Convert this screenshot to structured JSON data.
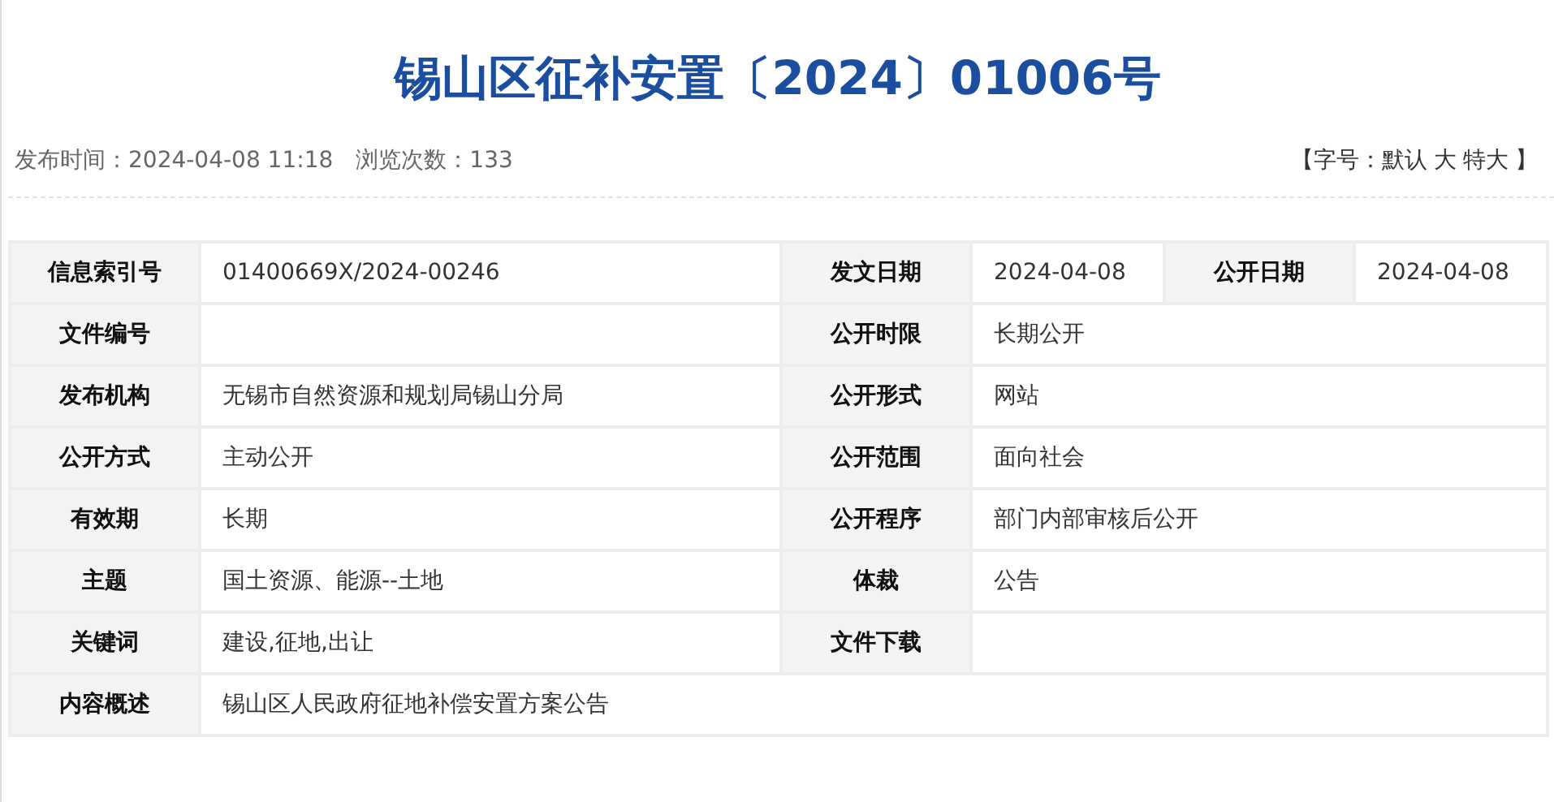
{
  "title": "锡山区征补安置〔2024〕01006号",
  "meta": {
    "published": "发布时间：2024-04-08 11:18",
    "views": "浏览次数：133"
  },
  "font_size": {
    "open": "【字号：",
    "options": [
      "默认",
      "大",
      "特大"
    ],
    "close": "】"
  },
  "table": {
    "rows": [
      {
        "cells": [
          {
            "label": "信息索引号",
            "value": "01400669X/2024-00246"
          },
          {
            "label": "发文日期",
            "value": "2024-04-08"
          },
          {
            "label": "公开日期",
            "value": "2024-04-08"
          }
        ]
      },
      {
        "cells": [
          {
            "label": "文件编号"
          },
          {
            "label": "公开时限",
            "value": "长期公开"
          }
        ]
      },
      {
        "cells": [
          {
            "label": "发布机构",
            "value": "无锡市自然资源和规划局锡山分局"
          },
          {
            "label": "公开形式",
            "value": "网站"
          }
        ]
      },
      {
        "cells": [
          {
            "label": "公开方式",
            "value": "主动公开"
          },
          {
            "label": "公开范围",
            "value": "面向社会"
          }
        ]
      },
      {
        "cells": [
          {
            "label": "有效期",
            "value": "长期"
          },
          {
            "label": "公开程序",
            "value": "部门内部审核后公开"
          }
        ]
      },
      {
        "cells": [
          {
            "label": "主题",
            "value": "国土资源、能源--土地"
          },
          {
            "label": "体裁",
            "value": "公告"
          }
        ]
      },
      {
        "cells": [
          {
            "label": "关键词",
            "value": "建设,征地,出让"
          },
          {
            "label": "文件下载"
          }
        ]
      },
      {
        "cells": [
          {
            "label": "内容概述",
            "value": "锡山区人民政府征地补偿安置方案公告"
          }
        ]
      }
    ]
  }
}
